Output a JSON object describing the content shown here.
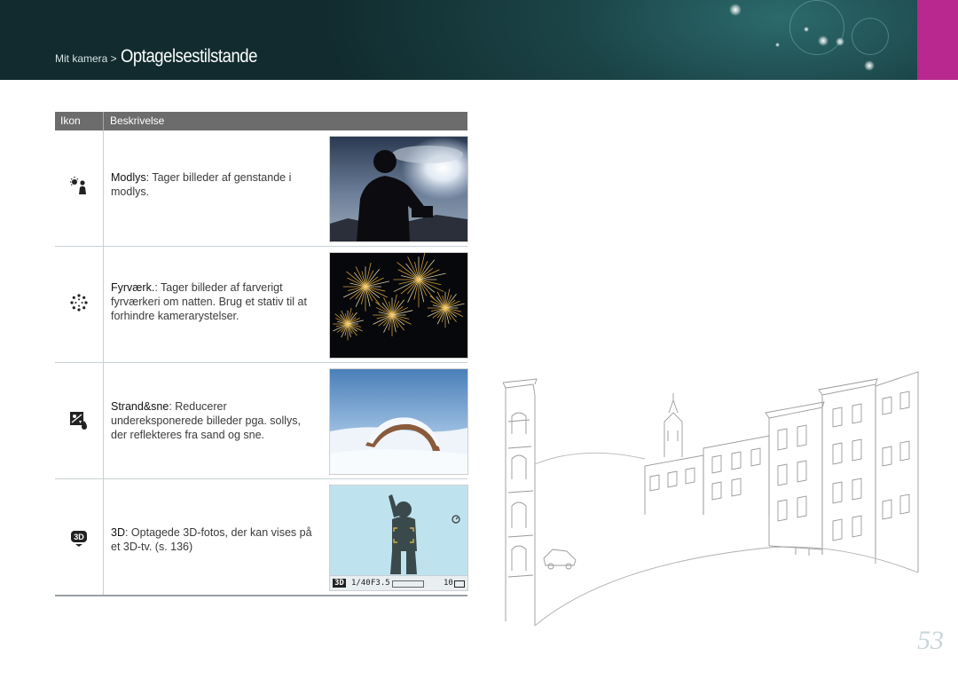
{
  "header": {
    "breadcrumb_parent": "Mit kamera >",
    "breadcrumb_current": "Optagelsestilstande"
  },
  "table": {
    "col_icon": "Ikon",
    "col_desc": "Beskrivelse",
    "rows": [
      {
        "icon": "backlight-icon",
        "name": "Modlys",
        "text": ": Tager billeder af genstande i modlys."
      },
      {
        "icon": "fireworks-icon",
        "name": "Fyrværk.",
        "text": ": Tager billeder af farverigt fyrværkeri om natten. Brug et stativ til at forhindre kamerarystelser."
      },
      {
        "icon": "beach-snow-icon",
        "name": "Strand&sne",
        "text": ": Reducerer undereksponerede billeder pga. sollys, der reflekteres fra sand og sne."
      },
      {
        "icon": "3d-icon",
        "name": "3D",
        "text": ": Optagede 3D-fotos, der kan vises på et 3D-tv. (s. 136)"
      }
    ]
  },
  "lcd": {
    "mode": "3D",
    "shutter": "1/40",
    "aperture": "F3.5",
    "shots": "10"
  },
  "page_number": "53",
  "colors": {
    "header_dark": "#112b2e",
    "accent_tab": "#b8288e",
    "table_header": "#6c6c6c",
    "lcd_sky": "#bfe3ee"
  }
}
